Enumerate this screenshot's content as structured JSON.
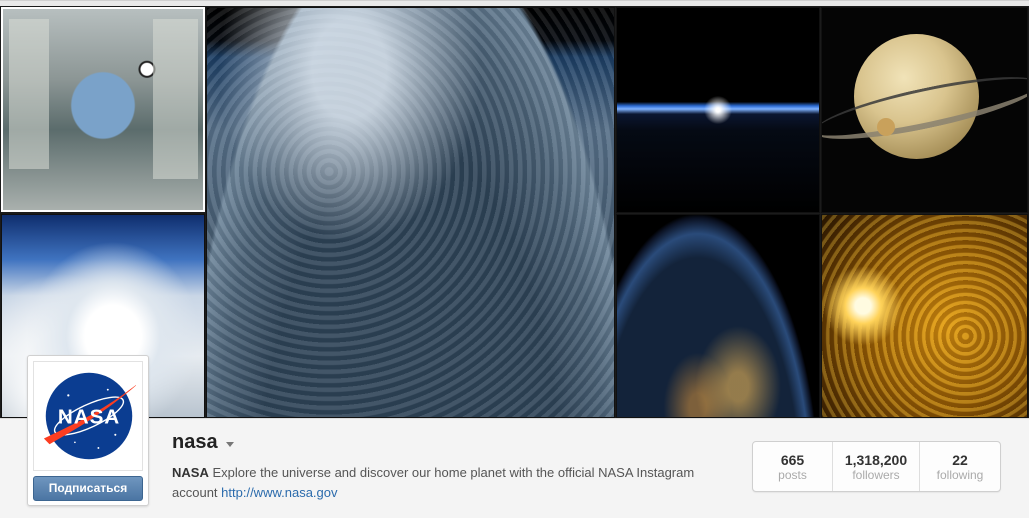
{
  "mosaic": {
    "tiles": [
      "iss-interior",
      "thunderstorm",
      "earth-clouds",
      "horizon-sunrise",
      "saturn-titan",
      "earth-night-lights",
      "solar-flare"
    ]
  },
  "profile": {
    "username": "nasa",
    "follow_label": "Подписаться",
    "bio_name": "NASA",
    "bio_text": " Explore the universe and discover our home planet with the official NASA Instagram account ",
    "bio_link": "http://www.nasa.gov",
    "logo_text": "NASA",
    "colors": {
      "logo_blue": "#0b3d91",
      "logo_red": "#fc3d21",
      "button_blue": "#4b75a3",
      "link": "#2b6bac"
    }
  },
  "stats": [
    {
      "value": "665",
      "label": "posts"
    },
    {
      "value": "1,318,200",
      "label": "followers"
    },
    {
      "value": "22",
      "label": "following"
    }
  ]
}
